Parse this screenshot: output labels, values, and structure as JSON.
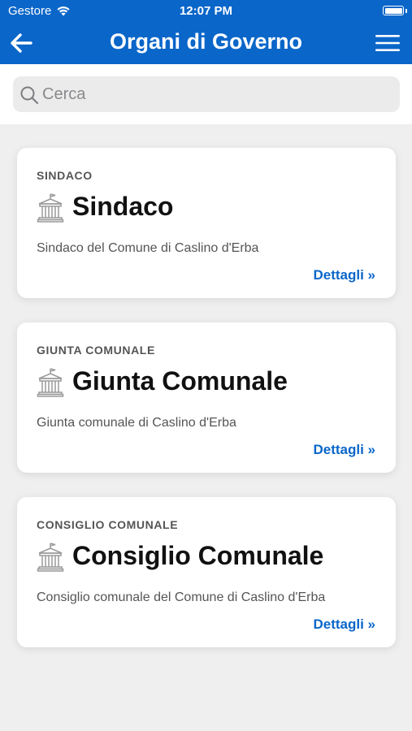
{
  "status_bar": {
    "carrier": "Gestore",
    "time": "12:07 PM"
  },
  "header": {
    "title": "Organi di Governo",
    "back_icon": "arrow-left-icon",
    "menu_icon": "hamburger-menu-icon",
    "background_color": "#0a66c9"
  },
  "search": {
    "placeholder": "Cerca",
    "value": ""
  },
  "cards": [
    {
      "kicker": "SINDACO",
      "title": "Sindaco",
      "description": "Sindaco del Comune di Caslino d'Erba",
      "link": "Dettagli »",
      "icon": "town-hall-icon"
    },
    {
      "kicker": "GIUNTA COMUNALE",
      "title": "Giunta Comunale",
      "description": "Giunta comunale di Caslino d'Erba",
      "link": "Dettagli »",
      "icon": "town-hall-icon"
    },
    {
      "kicker": "CONSIGLIO COMUNALE",
      "title": "Consiglio Comunale",
      "description": "Consiglio comunale del Comune di Caslino d'Erba",
      "link": "Dettagli »",
      "icon": "town-hall-icon"
    }
  ],
  "colors": {
    "accent": "#0a66c9",
    "page_background": "#efefef",
    "card_background": "#ffffff"
  }
}
